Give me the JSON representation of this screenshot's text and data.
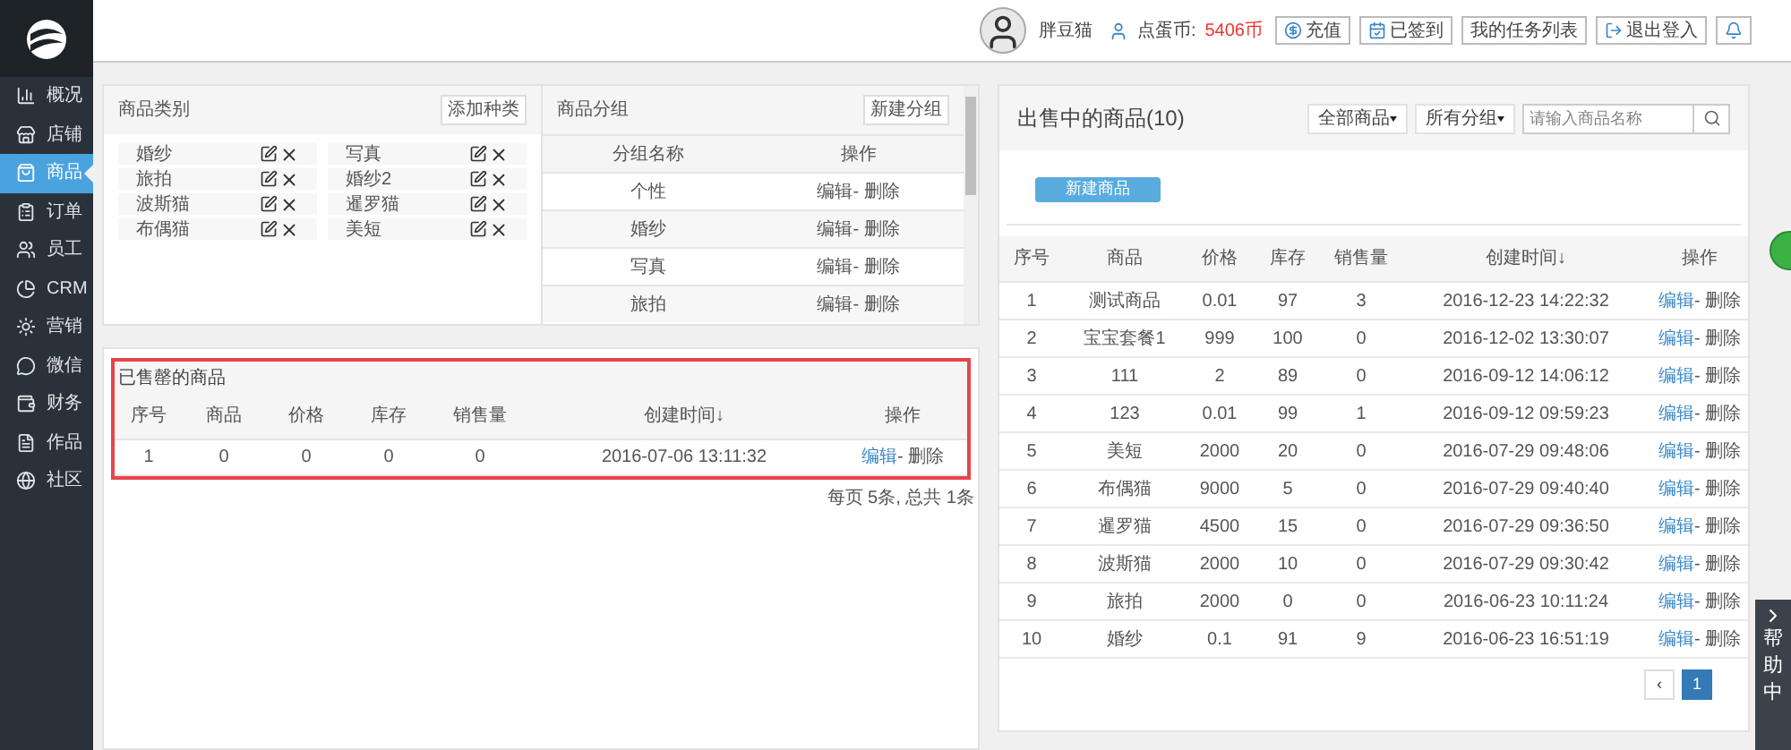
{
  "header": {
    "user_name": "胖豆猫",
    "coin_label": "点蛋币:",
    "coin_value": "5406币",
    "buttons": [
      {
        "kind": "recharge",
        "label": "充值"
      },
      {
        "kind": "signed",
        "label": "已签到"
      },
      {
        "kind": "plain",
        "label": "我的任务列表"
      },
      {
        "kind": "logout",
        "label": "退出登入"
      },
      {
        "kind": "bell"
      }
    ]
  },
  "sidebar": {
    "items": [
      {
        "label": "概况",
        "selected": false
      },
      {
        "label": "店铺",
        "selected": false
      },
      {
        "label": "商品",
        "selected": true
      },
      {
        "label": "订单",
        "selected": false
      },
      {
        "label": "员工",
        "selected": false
      },
      {
        "label": "CRM",
        "selected": false
      },
      {
        "label": "营销",
        "selected": false
      },
      {
        "label": "微信",
        "selected": false
      },
      {
        "label": "财务",
        "selected": false
      },
      {
        "label": "作品",
        "selected": false
      },
      {
        "label": "社区",
        "selected": false
      }
    ]
  },
  "categories": {
    "title": "商品类别",
    "add_button": "添加种类",
    "items": [
      "婚纱",
      "写真",
      "旅拍",
      "婚纱2",
      "波斯猫",
      "暹罗猫",
      "布偶猫",
      "美短"
    ]
  },
  "groups": {
    "title": "商品分组",
    "new_button": "新建分组",
    "columns": [
      "分组名称",
      "操作"
    ],
    "rows": [
      {
        "name": "个性",
        "edit": "编辑",
        "delete": "- 删除"
      },
      {
        "name": "婚纱",
        "edit": "编辑",
        "delete": "- 删除"
      },
      {
        "name": "写真",
        "edit": "编辑",
        "delete": "- 删除"
      },
      {
        "name": "旅拍",
        "edit": "编辑",
        "delete": "- 删除"
      }
    ]
  },
  "sold_out": {
    "title": "已售罄的商品",
    "columns": [
      "序号",
      "商品",
      "价格",
      "库存",
      "销售量",
      "创建时间↓",
      "操作"
    ],
    "rows": [
      {
        "cells": [
          "1",
          "0",
          "0",
          "0",
          "0",
          "2016-07-06 13:11:32"
        ],
        "edit": "编辑",
        "delete": "- 删除"
      }
    ],
    "pagination_info": "每页 5条, 总共 1条"
  },
  "on_sale": {
    "title": "出售中的商品(10)",
    "filters": [
      "全部商品",
      "所有分组"
    ],
    "search_placeholder": "请输入商品名称",
    "new_button": "新建商品",
    "columns": [
      "序号",
      "商品",
      "价格",
      "库存",
      "销售量",
      "创建时间↓",
      "操作"
    ],
    "rows": [
      {
        "cells": [
          "1",
          "测试商品",
          "0.01",
          "97",
          "3",
          "2016-12-23 14:22:32"
        ],
        "edit": "编辑",
        "delete": "- 删除"
      },
      {
        "cells": [
          "2",
          "宝宝套餐1",
          "999",
          "100",
          "0",
          "2016-12-02 13:30:07"
        ],
        "edit": "编辑",
        "delete": "- 删除"
      },
      {
        "cells": [
          "3",
          "111",
          "2",
          "89",
          "0",
          "2016-09-12 14:06:12"
        ],
        "edit": "编辑",
        "delete": "- 删除"
      },
      {
        "cells": [
          "4",
          "123",
          "0.01",
          "99",
          "1",
          "2016-09-12 09:59:23"
        ],
        "edit": "编辑",
        "delete": "- 删除"
      },
      {
        "cells": [
          "5",
          "美短",
          "2000",
          "20",
          "0",
          "2016-07-29 09:48:06"
        ],
        "edit": "编辑",
        "delete": "- 删除"
      },
      {
        "cells": [
          "6",
          "布偶猫",
          "9000",
          "5",
          "0",
          "2016-07-29 09:40:40"
        ],
        "edit": "编辑",
        "delete": "- 删除"
      },
      {
        "cells": [
          "7",
          "暹罗猫",
          "4500",
          "15",
          "0",
          "2016-07-29 09:36:50"
        ],
        "edit": "编辑",
        "delete": "- 删除"
      },
      {
        "cells": [
          "8",
          "波斯猫",
          "2000",
          "10",
          "0",
          "2016-07-29 09:30:42"
        ],
        "edit": "编辑",
        "delete": "- 删除"
      },
      {
        "cells": [
          "9",
          "旅拍",
          "2000",
          "0",
          "0",
          "2016-06-23 10:11:24"
        ],
        "edit": "编辑",
        "delete": "- 删除"
      },
      {
        "cells": [
          "10",
          "婚纱",
          "0.1",
          "91",
          "9",
          "2016-06-23 16:51:19"
        ],
        "edit": "编辑",
        "delete": "- 删除"
      }
    ],
    "pagination": [
      {
        "label": "‹",
        "selected": false
      },
      {
        "label": "1",
        "selected": true
      }
    ]
  },
  "help_tab": {
    "label": "帮助中"
  }
}
